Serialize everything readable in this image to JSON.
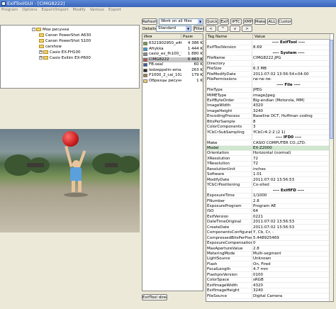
{
  "window": {
    "title": "ExifToolGUI - [CIMG8222]"
  },
  "menu": [
    "Program",
    "Options",
    "Export/Import",
    "Modify",
    "Various",
    "Export"
  ],
  "tree": [
    {
      "label": "Мои рисунки",
      "level": 0,
      "expander": "-"
    },
    {
      "label": "Canon PowerShot A630",
      "level": 1,
      "expander": ""
    },
    {
      "label": "Canon PowerShot S100",
      "level": 1,
      "expander": ""
    },
    {
      "label": "carshow",
      "level": 1,
      "expander": ""
    },
    {
      "label": "Casio EX-FH100",
      "level": 1,
      "expander": "+"
    },
    {
      "label": "Casio Exilim EX-P600",
      "level": 1,
      "expander": "+"
    }
  ],
  "files_toolbar": {
    "refresh": "Refresh",
    "filter_value": "Work on all files",
    "details": "Details:",
    "view_value": "Standard",
    "filter_btn": "Filter"
  },
  "file_columns": {
    "name": "Имя",
    "size": "Разм"
  },
  "files": [
    {
      "name": "6321902950_a46171...",
      "size": "4 386 K",
      "icon": "#6fa04a"
    },
    {
      "name": "Afrykka",
      "size": "1 444 K",
      "icon": "#3aa0d8"
    },
    {
      "name": "casio_ex_fh100_18",
      "size": "1 880 K",
      "icon": "#8a8a8a"
    },
    {
      "name": "CIMG8222",
      "size": "6 463 K",
      "icon": "#c0504d"
    },
    {
      "name": "FB-seal",
      "size": "60 K",
      "icon": "#3a5aa8"
    },
    {
      "name": "ledzeppelin-email-hea...",
      "size": "263 K",
      "icon": "#2a2a2a"
    },
    {
      "name": "P1000_2_cal_1024x768",
      "size": "179 K",
      "icon": "#a08050"
    },
    {
      "name": "Образцы рисунков",
      "size": "1 K",
      "icon": "#f2d16b"
    }
  ],
  "files_footer": {
    "button": "ExifTool direct"
  },
  "tag_tabs": [
    "Quick",
    "Exif",
    "IPTC",
    "XMP",
    "Maker",
    "ALL",
    "Custom"
  ],
  "tag_nav": [
    "<",
    "^",
    "v",
    ">"
  ],
  "tag_columns": {
    "name": "Tag Name",
    "value": "Value"
  },
  "tags": [
    {
      "name": "",
      "value": "---- ExifTool ----",
      "section": true
    },
    {
      "name": "ExifToolVersion",
      "value": "8.69"
    },
    {
      "name": "",
      "value": "---- System ----",
      "section": true
    },
    {
      "name": "FileName",
      "value": "CIMG8222.JPG"
    },
    {
      "name": "Directory",
      "value": "."
    },
    {
      "name": "FileSize",
      "value": "6.3 MB"
    },
    {
      "name": "FileModifyDate",
      "value": "2011:07:02 13:56:54+04:00"
    },
    {
      "name": "FilePermissions",
      "value": "rw-rw-rw-"
    },
    {
      "name": "",
      "value": "---- File ----",
      "section": true
    },
    {
      "name": "FileType",
      "value": "JPEG"
    },
    {
      "name": "MIMEType",
      "value": "image/jpeg"
    },
    {
      "name": "ExifByteOrder",
      "value": "Big-endian (Motorola, MM)"
    },
    {
      "name": "ImageWidth",
      "value": "4320"
    },
    {
      "name": "ImageHeight",
      "value": "3240"
    },
    {
      "name": "EncodingProcess",
      "value": "Baseline DCT, Huffman coding"
    },
    {
      "name": "BitsPerSample",
      "value": "8"
    },
    {
      "name": "ColorComponents",
      "value": "3"
    },
    {
      "name": "YCbCrSubSampling",
      "value": "YCbCr4:2:2 (2 1)"
    },
    {
      "name": "",
      "value": "---- IFD0 ----",
      "section": true
    },
    {
      "name": "Make",
      "value": "CASIO COMPUTER CO.,LTD."
    },
    {
      "name": "Model",
      "value": "EX-Z2000",
      "highlight": true
    },
    {
      "name": "Orientation",
      "value": "Horizontal (normal)"
    },
    {
      "name": "XResolution",
      "value": "72"
    },
    {
      "name": "YResolution",
      "value": "72"
    },
    {
      "name": "ResolutionUnit",
      "value": "inches"
    },
    {
      "name": "Software",
      "value": "1.01"
    },
    {
      "name": "ModifyDate",
      "value": "2011:07:02 13:56:53"
    },
    {
      "name": "YCbCrPositioning",
      "value": "Co-sited"
    },
    {
      "name": "",
      "value": "---- ExifIFD ----",
      "section": true
    },
    {
      "name": "ExposureTime",
      "value": "1/1000"
    },
    {
      "name": "FNumber",
      "value": "2.8"
    },
    {
      "name": "ExposureProgram",
      "value": "Program AE"
    },
    {
      "name": "ISO",
      "value": "64"
    },
    {
      "name": "ExifVersion",
      "value": "0221"
    },
    {
      "name": "DateTimeOriginal",
      "value": "2011:07:02 13:56:53"
    },
    {
      "name": "CreateDate",
      "value": "2011:07:02 13:56:53"
    },
    {
      "name": "ComponentsConfiguration",
      "value": "Y, Cb, Cr, -"
    },
    {
      "name": "CompressedBitsPerPixel",
      "value": "5.448925469"
    },
    {
      "name": "ExposureCompensation",
      "value": "0"
    },
    {
      "name": "MaxApertureValue",
      "value": "2.8"
    },
    {
      "name": "MeteringMode",
      "value": "Multi-segment"
    },
    {
      "name": "LightSource",
      "value": "Unknown"
    },
    {
      "name": "Flash",
      "value": "On, Fired"
    },
    {
      "name": "FocalLength",
      "value": "4.7 mm"
    },
    {
      "name": "FlashpixVersion",
      "value": "0100"
    },
    {
      "name": "ColorSpace",
      "value": "sRGB"
    },
    {
      "name": "ExifImageWidth",
      "value": "4320"
    },
    {
      "name": "ExifImageHeight",
      "value": "3240"
    },
    {
      "name": "FileSource",
      "value": "Digital Camera"
    }
  ]
}
